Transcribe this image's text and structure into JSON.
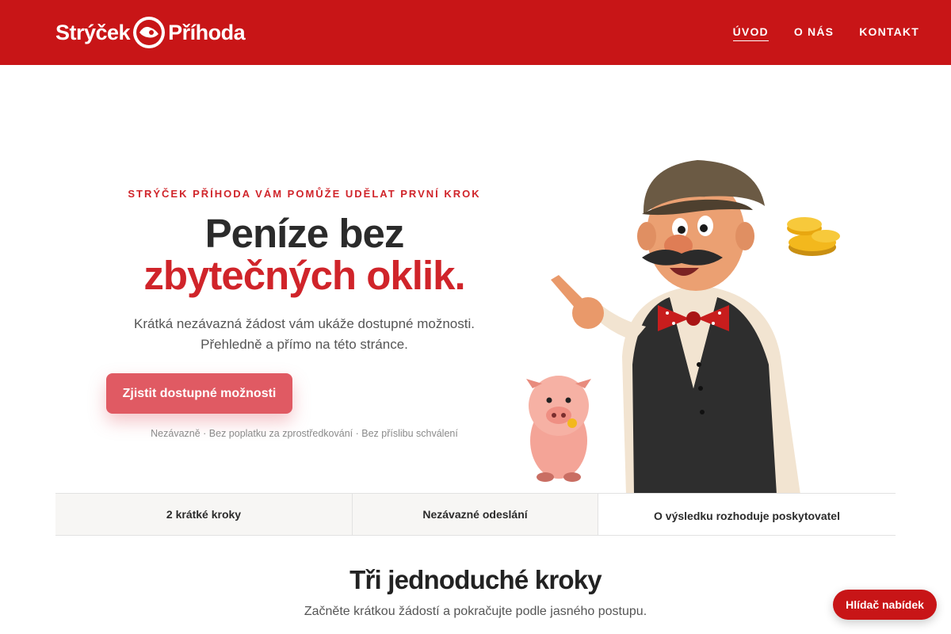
{
  "header": {
    "logo_left": "Strýček",
    "logo_right": "Příhoda",
    "nav": [
      {
        "label": "ÚVOD",
        "active": true
      },
      {
        "label": "O NÁS",
        "active": false
      },
      {
        "label": "KONTAKT",
        "active": false
      }
    ],
    "brand_color": "#c81517"
  },
  "hero": {
    "kicker": "STRÝČEK PŘÍHODA VÁM POMŮŽE UDĚLAT PRVNÍ KROK",
    "title_line1": "Peníze bez",
    "title_line2": "zbytečných oklik.",
    "lead_line1": "Krátká nezávazná žádost vám ukáže dostupné možnosti.",
    "lead_line2": "Přehledně a přímo na této stránce.",
    "cta_label": "Zjistit dostupné možnosti",
    "fineprint": "Nezávazně · Bez poplatku za zprostředkování · Bez příslibu schválení",
    "illustration_icons": [
      "mascot-uncle-icon",
      "piggy-icon",
      "coins-icon"
    ]
  },
  "features": [
    "2 krátké kroky",
    "Nezávazné odeslání",
    "O výsledku rozhoduje poskytovatel"
  ],
  "steps": {
    "title": "Tři jednoduché kroky",
    "subtitle": "Začněte krátkou žádostí a pokračujte podle jasného postupu."
  },
  "floating": {
    "watch_label": "Hlídač nabídek"
  },
  "colors": {
    "accent": "#d0242a",
    "cta": "#e05a63"
  }
}
